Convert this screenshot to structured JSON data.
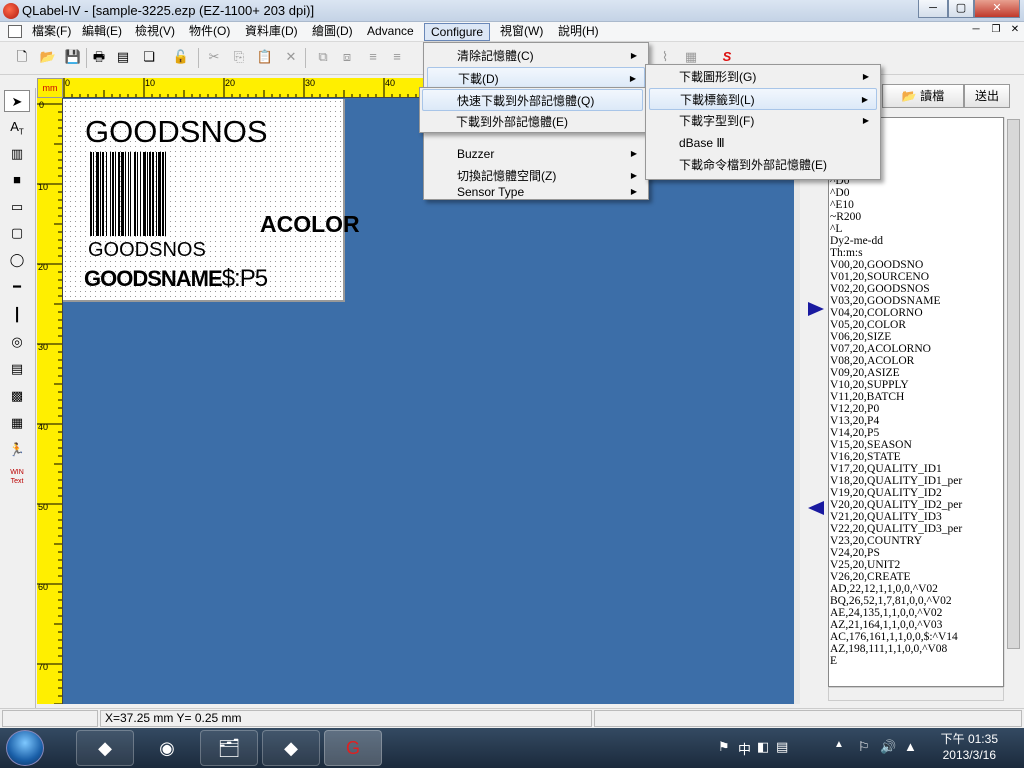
{
  "window": {
    "title": "QLabel-IV  - [sample-3225.ezp    (EZ-1100+     203 dpi)]",
    "min": "─",
    "max": "▢",
    "close": "✕"
  },
  "menubar": {
    "items": [
      "檔案(F)",
      "編輯(E)",
      "檢視(V)",
      "物件(O)",
      "資料庫(D)",
      "繪圖(D)",
      "Advance",
      "Configure",
      "視窗(W)",
      "說明(H)"
    ]
  },
  "configure_menu": {
    "items": [
      "清除記憶體(C)",
      "下載(D)",
      "快速下載到外部記憶體(Q)",
      "下載到外部記憶體(E)",
      "Buzzer",
      "切換記憶體空間(Z)",
      "Sensor Type"
    ]
  },
  "download_submenu": {
    "items": [
      "下載圖形到(G)",
      "下載標籤到(L)",
      "下載字型到(F)",
      "dBase Ⅲ",
      "下載命令檔到外部記憶體(E)"
    ]
  },
  "ruler": {
    "unit": "mm",
    "top": [
      "0",
      "10",
      "20",
      "30",
      "40"
    ],
    "left": [
      "0",
      "10",
      "20",
      "30",
      "40",
      "50",
      "60",
      "70"
    ]
  },
  "label": {
    "goodsnos_big": "GOODSNOS",
    "acolor": "ACOLOR",
    "goodsnos_small": "GOODSNOS",
    "goodsname_a": "GOODSNAME",
    "goodsname_b": "$:P5"
  },
  "right_panel": {
    "read_btn": "讀檔",
    "send_btn": "送出"
  },
  "commands": [
    "^D0",
    "^D0",
    "^E10",
    "~R200",
    "^L",
    "Dy2-me-dd",
    "Th:m:s",
    "V00,20,GOODSNO",
    "V01,20,SOURCENO",
    "V02,20,GOODSNOS",
    "V03,20,GOODSNAME",
    "V04,20,COLORNO",
    "V05,20,COLOR",
    "V06,20,SIZE",
    "V07,20,ACOLORNO",
    "V08,20,ACOLOR",
    "V09,20,ASIZE",
    "V10,20,SUPPLY",
    "V11,20,BATCH",
    "V12,20,P0",
    "V13,20,P4",
    "V14,20,P5",
    "V15,20,SEASON",
    "V16,20,STATE",
    "V17,20,QUALITY_ID1",
    "V18,20,QUALITY_ID1_per",
    "V19,20,QUALITY_ID2",
    "V20,20,QUALITY_ID2_per",
    "V21,20,QUALITY_ID3",
    "V22,20,QUALITY_ID3_per",
    "V23,20,COUNTRY",
    "V24,20,PS",
    "V25,20,UNIT2",
    "V26,20,CREATE",
    "AD,22,12,1,1,0,0,^V02",
    "BQ,26,52,1,7,81,0,0,^V02",
    "AE,24,135,1,1,0,0,^V02",
    "AZ,21,164,1,1,0,0,^V03",
    "AC,176,161,1,1,0,0,$:^V14",
    "AZ,198,111,1,1,0,0,^V08",
    "E"
  ],
  "status": {
    "coords": "X=37.25 mm  Y= 0.25 mm"
  },
  "taskbar": {
    "time": "下午 01:35",
    "date": "2013/3/16",
    "ime": "中"
  },
  "colors": {
    "canvas": "#3c6ea8",
    "ruler": "#ffef00",
    "menu_highlight": "#dce9f8"
  }
}
